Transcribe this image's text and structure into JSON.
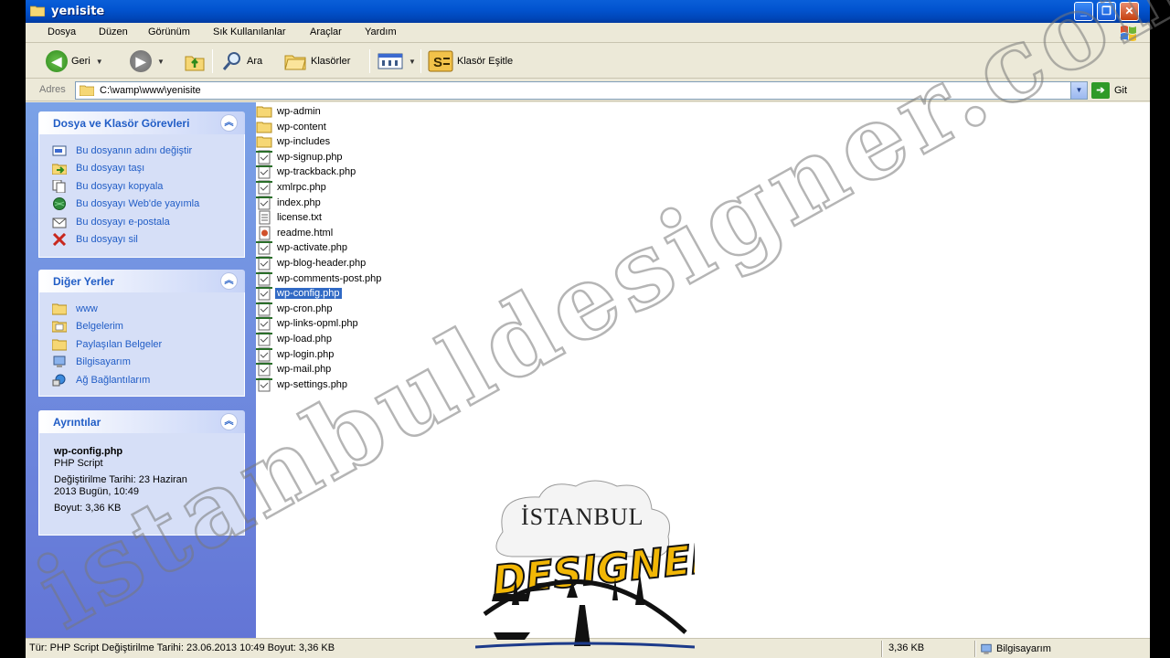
{
  "window": {
    "title": "yenisite"
  },
  "menu": {
    "items": [
      "Dosya",
      "Düzen",
      "Görünüm",
      "Sık Kullanılanlar",
      "Araçlar",
      "Yardım"
    ]
  },
  "toolbar": {
    "back_label": "Geri",
    "search_label": "Ara",
    "folders_label": "Klasörler",
    "sync_label": "Klasör Eşitle"
  },
  "address": {
    "label": "Adres",
    "path": "C:\\wamp\\www\\yenisite",
    "go_label": "Git"
  },
  "tasks_panel": {
    "title": "Dosya ve Klasör Görevleri",
    "items": [
      {
        "label": "Bu dosyanın adını değiştir",
        "icon": "rename-icon"
      },
      {
        "label": "Bu dosyayı taşı",
        "icon": "move-icon"
      },
      {
        "label": "Bu dosyayı kopyala",
        "icon": "copy-icon"
      },
      {
        "label": "Bu dosyayı Web'de yayımla",
        "icon": "web-publish-icon"
      },
      {
        "label": "Bu dosyayı e-postala",
        "icon": "email-icon"
      },
      {
        "label": "Bu dosyayı sil",
        "icon": "delete-icon"
      }
    ]
  },
  "places_panel": {
    "title": "Diğer Yerler",
    "items": [
      {
        "label": "www",
        "icon": "folder-icon"
      },
      {
        "label": "Belgelerim",
        "icon": "documents-icon"
      },
      {
        "label": "Paylaşılan Belgeler",
        "icon": "shared-folder-icon"
      },
      {
        "label": "Bilgisayarım",
        "icon": "computer-icon"
      },
      {
        "label": "Ağ Bağlantılarım",
        "icon": "network-icon"
      }
    ]
  },
  "details_panel": {
    "title": "Ayrıntılar",
    "file_name": "wp-config.php",
    "file_type": "PHP Script",
    "modified_line1": "Değiştirilme Tarihi: 23 Haziran",
    "modified_line2": "2013 Bugün, 10:49",
    "size": "Boyut: 3,36 KB"
  },
  "files": [
    {
      "name": "wp-admin",
      "type": "folder"
    },
    {
      "name": "wp-content",
      "type": "folder"
    },
    {
      "name": "wp-includes",
      "type": "folder"
    },
    {
      "name": "wp-signup.php",
      "type": "php"
    },
    {
      "name": "wp-trackback.php",
      "type": "php"
    },
    {
      "name": "xmlrpc.php",
      "type": "php"
    },
    {
      "name": "index.php",
      "type": "php"
    },
    {
      "name": "license.txt",
      "type": "txt"
    },
    {
      "name": "readme.html",
      "type": "html"
    },
    {
      "name": "wp-activate.php",
      "type": "php"
    },
    {
      "name": "wp-blog-header.php",
      "type": "php"
    },
    {
      "name": "wp-comments-post.php",
      "type": "php"
    },
    {
      "name": "wp-config.php",
      "type": "php",
      "selected": true
    },
    {
      "name": "wp-cron.php",
      "type": "php"
    },
    {
      "name": "wp-links-opml.php",
      "type": "php"
    },
    {
      "name": "wp-load.php",
      "type": "php"
    },
    {
      "name": "wp-login.php",
      "type": "php"
    },
    {
      "name": "wp-mail.php",
      "type": "php"
    },
    {
      "name": "wp-settings.php",
      "type": "php"
    }
  ],
  "status": {
    "info": "Tür: PHP Script Değiştirilme Tarihi: 23.06.2013 10:49 Boyut: 3,36 KB",
    "size": "3,36 KB",
    "zone": "Bilgisayarım"
  },
  "watermark": {
    "text": "istanbuldesigner.com"
  },
  "logo": {
    "top_text": "İSTANBUL",
    "main_text": "DESIGNER"
  },
  "colors": {
    "xp_title_blue": "#0254d0",
    "task_pane_blue": "#6375d6",
    "link_blue": "#215dc6",
    "selection": "#316ac5",
    "logo_yellow": "#f2b705"
  }
}
